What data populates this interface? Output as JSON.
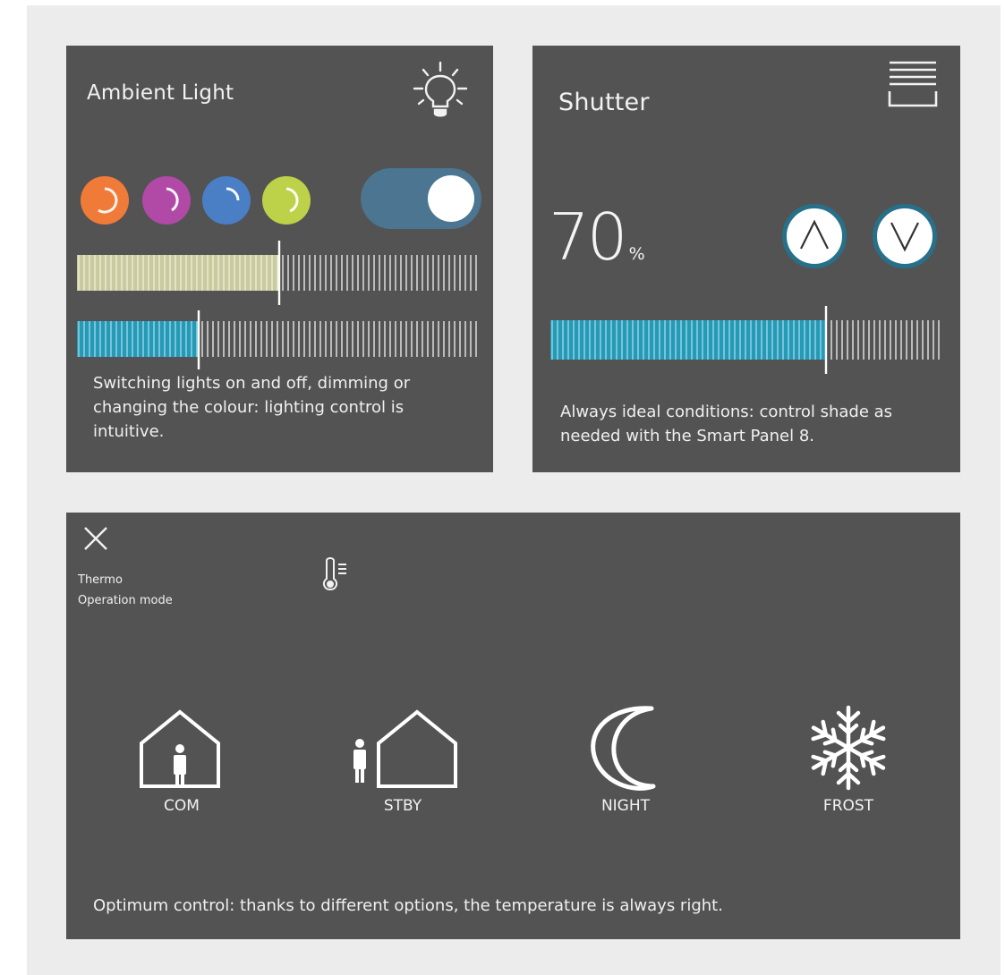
{
  "colors": {
    "frame": "#ececec",
    "panel": "#535353",
    "accent": "#2599b6",
    "warm": "#c9caa0",
    "toggle": "#4b7590"
  },
  "ambient": {
    "title": "Ambient Light",
    "icon": "lightbulb-icon",
    "color_swatches": [
      {
        "name": "orange",
        "color": "#f07b39"
      },
      {
        "name": "purple",
        "color": "#b04aa6"
      },
      {
        "name": "blue",
        "color": "#4a7fc6"
      },
      {
        "name": "green",
        "color": "#bdd149"
      }
    ],
    "toggle_on": true,
    "dimmer_level": 0.5,
    "color_temp_level": 0.3,
    "caption": "Switching lights on and off, dimming or changing the colour: lighting control is intuitive."
  },
  "shutter": {
    "title": "Shutter",
    "icon": "shutter-icon",
    "value": "70",
    "unit": "%",
    "position_level": 0.7,
    "caption": "Always ideal conditions: control shade as needed with the Smart Panel 8."
  },
  "thermo": {
    "title": "Thermo",
    "subtitle": "Operation mode",
    "icon": "thermometer-icon",
    "modes": [
      {
        "label": "COM",
        "icon": "house-with-person-icon"
      },
      {
        "label": "STBY",
        "icon": "person-beside-house-icon"
      },
      {
        "label": "NIGHT",
        "icon": "moon-icon"
      },
      {
        "label": "FROST",
        "icon": "snowflake-icon"
      }
    ],
    "caption": "Optimum control: thanks to different options, the temperature is always right."
  }
}
